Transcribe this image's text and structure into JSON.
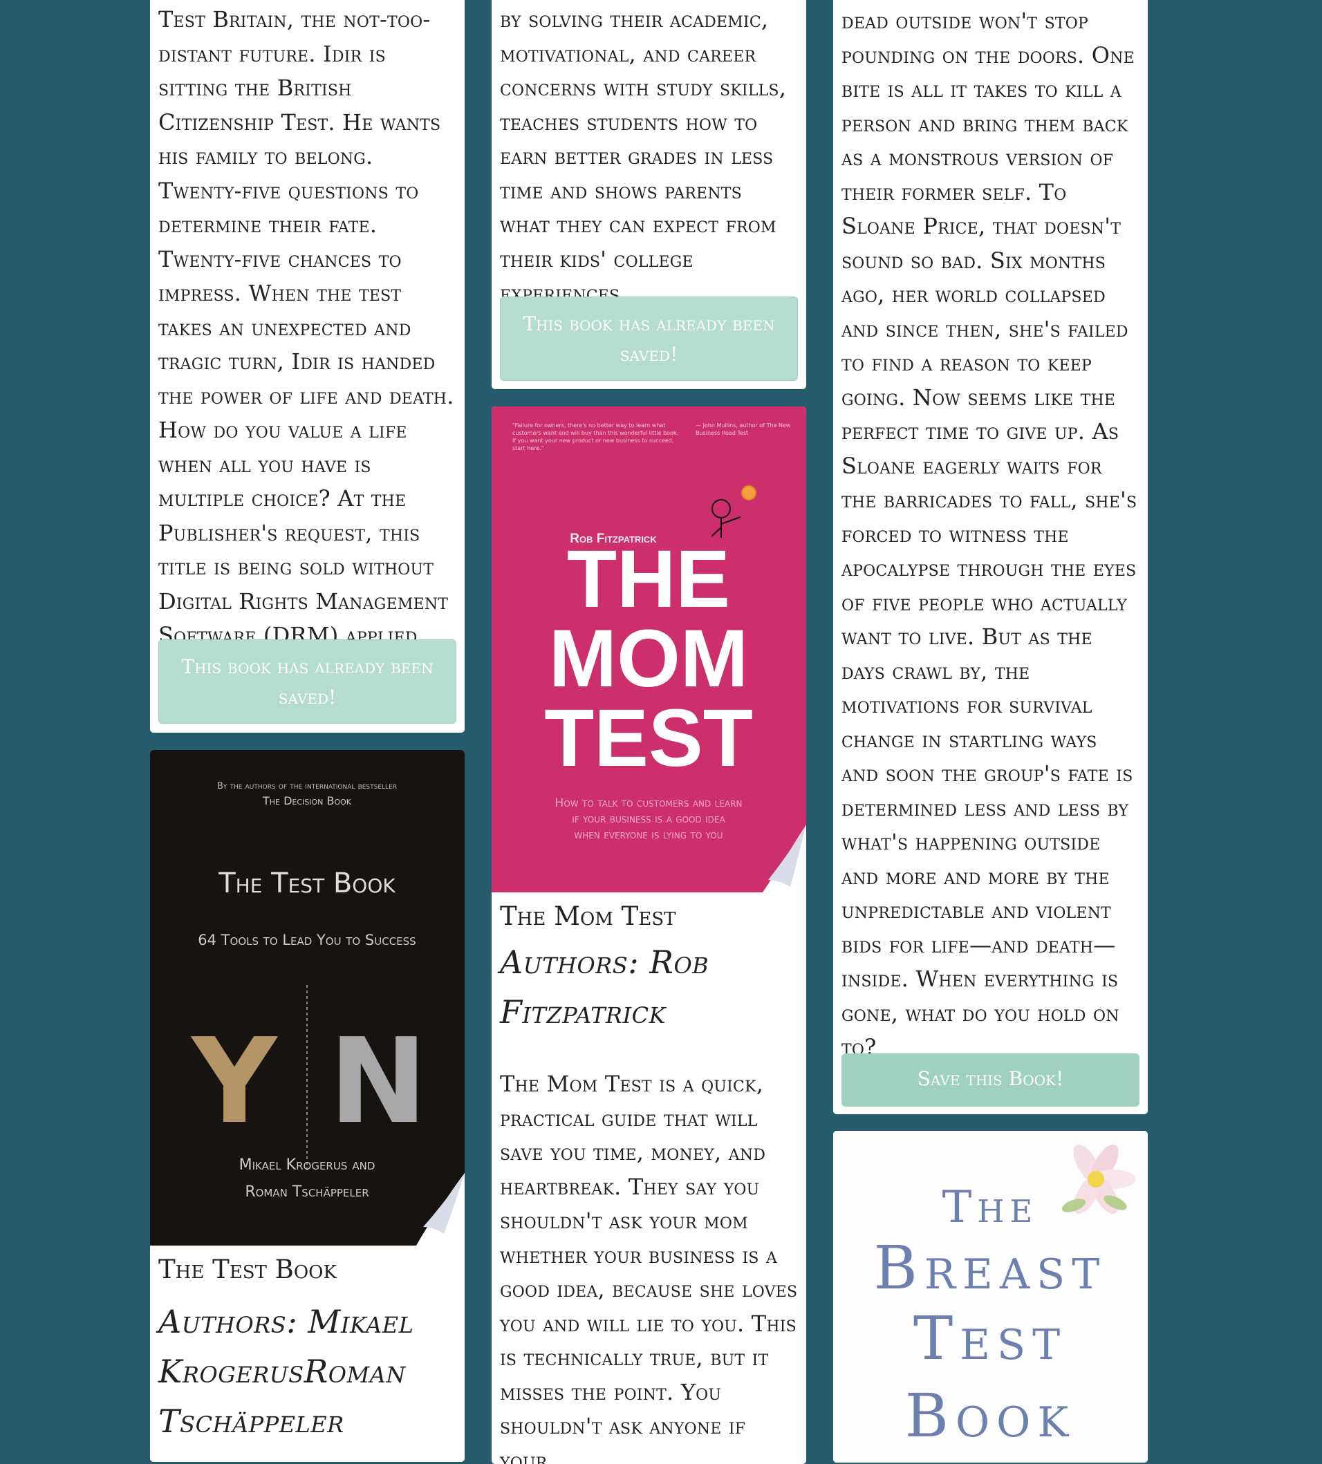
{
  "books": [
    {
      "description": "Test Britain, the not-too-distant future. Idir is sitting the British Citizenship Test. He wants his family to belong. Twenty-five questions to determine their fate. Twenty-five chances to impress. When the test takes an unexpected and tragic turn, Idir is handed the power of life and death. How do you value a life when all you have is multiple choice? At the Publisher's request, this title is being sold without Digital Rights Management Software (DRM) applied.",
      "button_label": "This book has already been saved!"
    },
    {
      "description": "by solving their academic, motivational, and career concerns with study skills, teaches students how to earn better grades in less time and shows parents what they can expect from their kids' college experiences.",
      "button_label": "This book has already been saved!"
    },
    {
      "description": "dead outside won't stop pounding on the doors. One bite is all it takes to kill a person and bring them back as a monstrous version of their former self. To Sloane Price, that doesn't sound so bad. Six months ago, her world collapsed and since then, she's failed to find a reason to keep going. Now seems like the perfect time to give up. As Sloane eagerly waits for the barricades to fall, she's forced to witness the apocalypse through the eyes of five people who actually want to live. But as the days crawl by, the motivations for survival change in startling ways and soon the group's fate is determined less and less by what's happening outside and more and more by the unpredictable and violent bids for life—and death—inside. When everything is gone, what do you hold on to?",
      "button_label": "Save this Book!"
    },
    {
      "title": "The Test Book",
      "authors": "Authors: Mikael KrogerusRoman Tschäppeler",
      "cover": {
        "top_line": "By the authors of the international bestseller",
        "top_line2": "The Decision Book",
        "title": "The Test Book",
        "subtitle": "64 Tools to Lead You to Success",
        "letter_y": "Y",
        "letter_n": "N",
        "author1": "Mikael Krogerus and",
        "author2": "Roman Tschäppeler",
        "bg_color": "#161310",
        "y_color": "#b49367",
        "n_color": "#a8a8ab"
      }
    },
    {
      "title": "The Mom Test",
      "authors": "Authors: Rob Fitzpatrick",
      "description": "The Mom Test is a quick, practical guide that will save you time, money, and heartbreak. They say you shouldn't ask your mom whether your business is a good idea, because she loves you and will lie to you. This is technically true, but it misses the point. You shouldn't ask anyone if your",
      "cover": {
        "quote1": "\"Failure for owners, there's no better way to learn what customers want and will buy than this wonderful little book. If you want your new product or new business to succeed, start here.\"",
        "quote2": "— John Mullins, author of The New Business Road Test",
        "author": "Rob Fitzpatrick",
        "line1": "THE",
        "line2": "MOM",
        "line3": "TEST",
        "tagline1": "How to talk to customers and learn",
        "tagline2": "if your business is a good idea",
        "tagline3": "when everyone is lying to you",
        "bg_color": "#cc2f6b"
      }
    },
    {
      "cover": {
        "line1": "The",
        "line2": "Breast",
        "line3": "Test",
        "line4": "Book",
        "text_color": "#6d7fae"
      }
    }
  ]
}
